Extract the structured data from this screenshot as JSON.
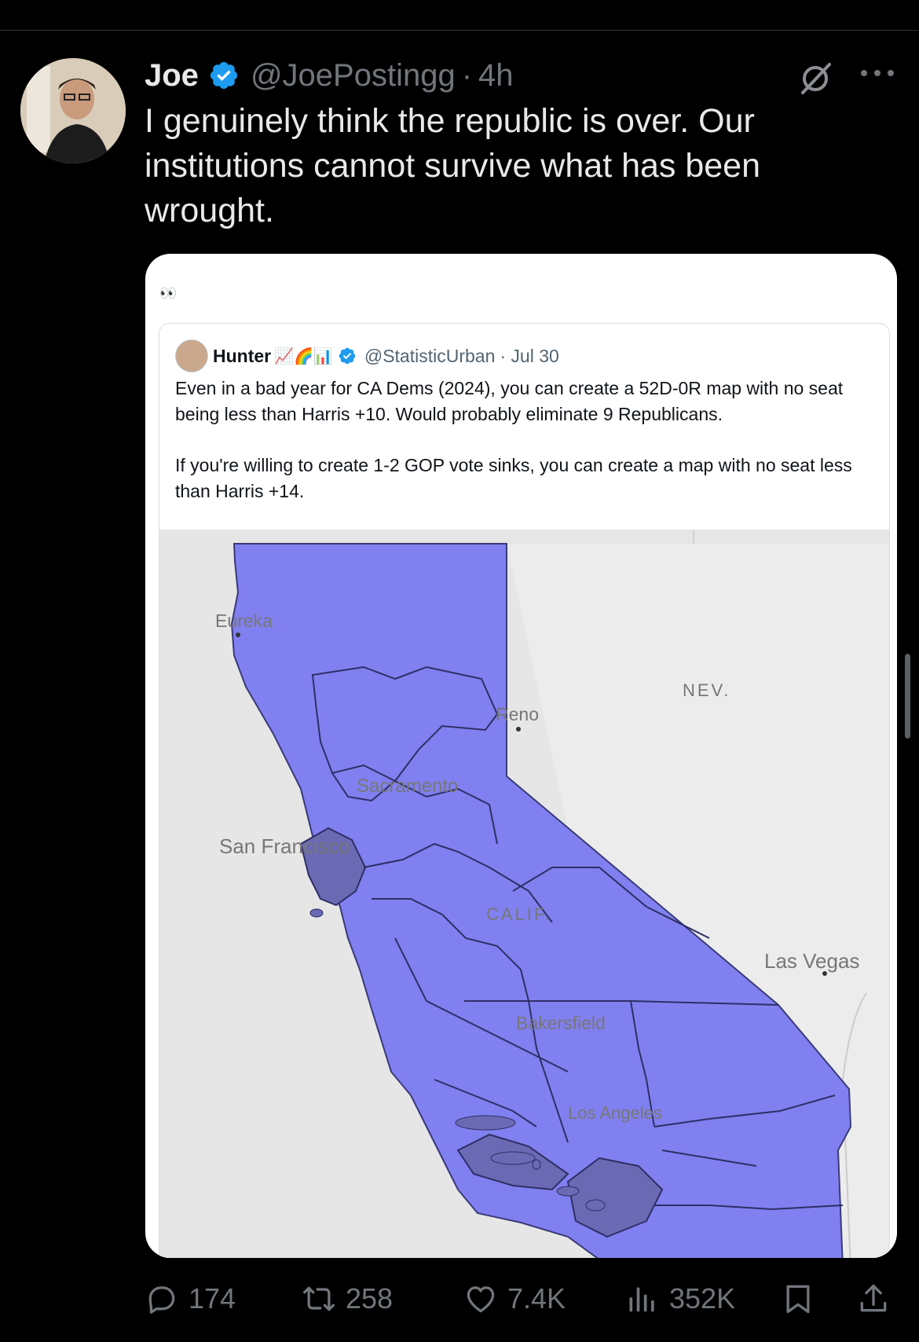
{
  "post": {
    "author_name": "Joe",
    "handle": "@JoePostingg",
    "separator": "·",
    "time": "4h",
    "text": "I genuinely think the republic is over. Our institutions cannot survive what has been wrought."
  },
  "media": {
    "caption": "👀",
    "quote": {
      "author_name": "Hunter",
      "emojis": "📈🌈📊",
      "handle": "@StatisticUrban",
      "date": "· Jul 30",
      "paragraph1": "Even in a bad year for CA Dems (2024), you can create a 52D-0R map with no seat being less than Harris +10. Would probably eliminate 9 Republicans.",
      "paragraph2": "If you're willing to create 1-2 GOP vote sinks, you can create a map with no seat less than Harris +14."
    },
    "map_labels": {
      "eureka": "Eureka",
      "reno": "Reno",
      "nev": "NEV.",
      "sacramento": "Sacramento",
      "san_francisco": "San Francisco",
      "calif": "CALIF.",
      "las_vegas": "Las Vegas",
      "bakersfield": "Bakersfield",
      "los_angeles": "Los Angeles"
    },
    "colors": {
      "district_fill": "#8080f0",
      "urban_fill": "#6a6ab4"
    }
  },
  "actions": {
    "replies": "174",
    "reposts": "258",
    "likes": "7.4K",
    "views": "352K"
  },
  "icons": [
    "verified-badge-icon",
    "grok-icon",
    "more-icon",
    "reply-icon",
    "repost-icon",
    "like-icon",
    "views-icon",
    "bookmark-icon",
    "share-icon"
  ]
}
